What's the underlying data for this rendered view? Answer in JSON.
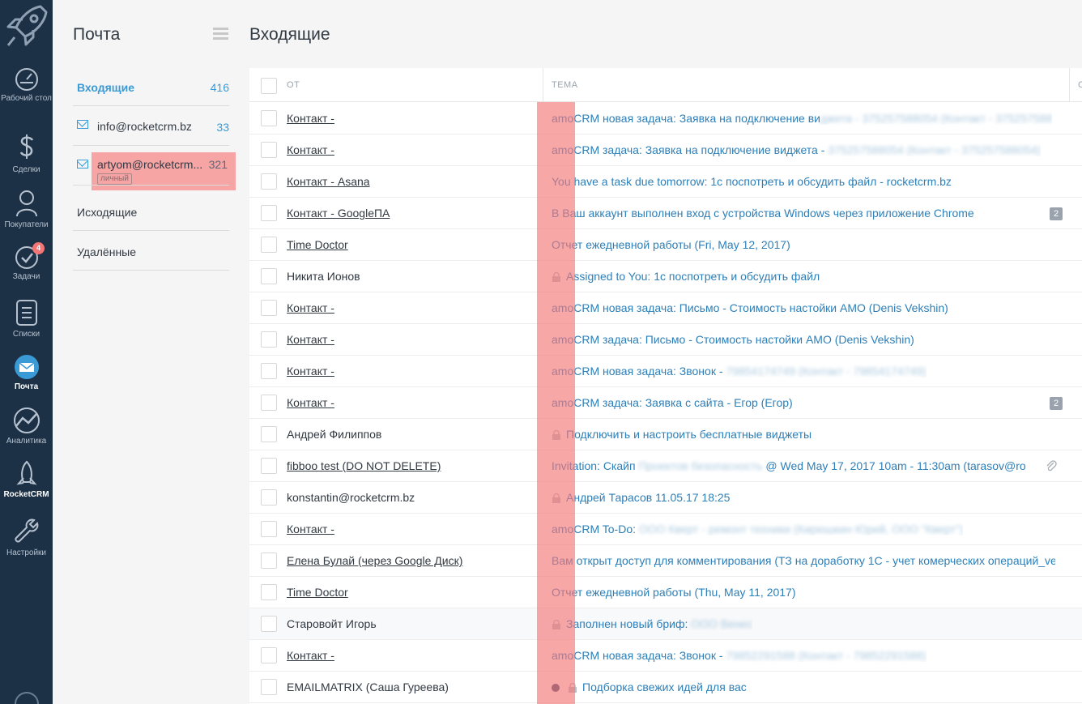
{
  "nav": {
    "items": [
      {
        "label": "Рабочий стол",
        "icon": "dashboard-icon"
      },
      {
        "label": "Сделки",
        "icon": "dollar-icon"
      },
      {
        "label": "Покупатели",
        "icon": "customers-icon"
      },
      {
        "label": "Задачи",
        "icon": "tasks-icon",
        "badge": "4"
      },
      {
        "label": "Списки",
        "icon": "lists-icon"
      },
      {
        "label": "Почта",
        "icon": "mail-icon",
        "active": true
      },
      {
        "label": "Аналитика",
        "icon": "analytics-icon"
      },
      {
        "label": "RocketCRM",
        "icon": "rocket-icon"
      },
      {
        "label": "Настройки",
        "icon": "settings-icon"
      }
    ]
  },
  "mail": {
    "title": "Почта",
    "folders": [
      {
        "name": "Входящие",
        "count": "416"
      },
      {
        "name": "info@rocketcrm.bz",
        "count": "33"
      },
      {
        "name": "artyom@rocketcrm...",
        "count": "321",
        "tag": "личный"
      },
      {
        "name": "Исходящие",
        "count": ""
      },
      {
        "name": "Удалённые",
        "count": ""
      }
    ]
  },
  "main": {
    "title": "Входящие",
    "col_from": "ОТ",
    "col_subject": "ТЕМА",
    "col_more": "С"
  },
  "rows": [
    {
      "from": "Контакт -",
      "subject": "amoCRM новая задача: Заявка на подключение ви",
      "blur": "джета - 375257588054 (Контакт - 375257588"
    },
    {
      "from": "Контакт -",
      "subject": "amoCRM задача: Заявка на подключение виджета - ",
      "blur": "375257588054 (Контакт - 375257588054)"
    },
    {
      "from": "Контакт - Asana",
      "subject": "You have a task due tomorrow: 1c поспотреть и обсудить файл - rocketcrm.bz",
      "blur": ""
    },
    {
      "from": "Контакт - GoogleПА",
      "subject": "В Ваш аккаунт выполнен вход с устройства Windows через приложение Chrome",
      "blur": "",
      "count": "2"
    },
    {
      "from": "Time Doctor",
      "subject": "Отчет ежедневной работы (Fri, May 12, 2017)",
      "blur": ""
    },
    {
      "from": "Никита Ионов",
      "subject": "Assigned to You: 1c поспотреть и обсудить файл",
      "blur": ""
    },
    {
      "from": "Контакт -",
      "subject": "amoCRM новая задача: Письмо - Стоимость настойки АМО (Denis Vekshin)",
      "blur": ""
    },
    {
      "from": "Контакт -",
      "subject": "amoCRM задача: Письмо - Стоимость настойки АМО (Denis Vekshin)",
      "blur": ""
    },
    {
      "from": "Контакт -",
      "subject": "amoCRM новая задача: Звонок - ",
      "blur": "79854174749 (Контакт - 79854174749)"
    },
    {
      "from": "Контакт -",
      "subject": "amoCRM задача: Заявка с сайта - Егор (Егор)",
      "blur": "",
      "count": "2"
    },
    {
      "from": "Андрей Филиппов",
      "subject": "Подключить и настроить бесплатные виджеты",
      "blur": ""
    },
    {
      "from": "fibboo test (DO NOT DELETE)",
      "subject": "Invitation: Скайп ",
      "blur": "Проектов безопасность",
      "tail": " @ Wed May 17, 2017 10am - 11:30am (tarasov@ro"
    },
    {
      "from": "konstantin@rocketcrm.bz",
      "subject": "Андрей Тарасов 11.05.17 18:25",
      "blur": ""
    },
    {
      "from": "Контакт -",
      "subject": "amoCRM To-Do: ",
      "blur": "ООО Кверт - ремонт техники (Кирюшкин Юрий, ООО \"Кверт\")"
    },
    {
      "from": "Елена Булай (через Google Диск)",
      "subject": "Вам открыт доступ для комментирования (ТЗ на доработку 1С - учет комерческих операций_ve",
      "blur": ""
    },
    {
      "from": "Time Doctor",
      "subject": "Отчет ежедневной работы (Thu, May 11, 2017)",
      "blur": ""
    },
    {
      "from": "Старовойт Игорь",
      "subject": "Заполнен новый бриф: ",
      "blur": "ООО Венес"
    },
    {
      "from": "Контакт -",
      "subject": "amoCRM новая задача: Звонок - ",
      "blur": "79852291588 (Контакт - 79852291588)"
    },
    {
      "from": "EMAILMATRIX (Саша Гуреева)",
      "subject": "Подборка свежих идей для вас",
      "blur": ""
    }
  ]
}
